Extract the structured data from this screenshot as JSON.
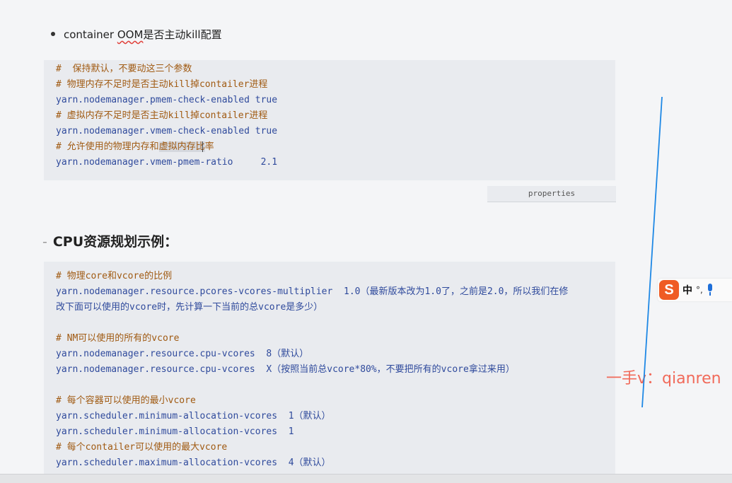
{
  "bullet": {
    "label_prefix": "container ",
    "label_underlined": "OOM",
    "label_suffix": "是否主动kill配置"
  },
  "code1": {
    "lines": [
      {
        "kind": "cmt",
        "text": "#  保持默认，不要动这三个参数"
      },
      {
        "kind": "cmt",
        "text": "# 物理内存不足时是否主动kill掉contailer进程"
      },
      {
        "kind": "cfg",
        "text": "yarn.nodemanager.pmem-check-enabled true"
      },
      {
        "kind": "cmt",
        "text": "# 虚拟内存不足时是否主动kill掉contailer进程"
      },
      {
        "kind": "cfg",
        "text": "yarn.nodemanager.vmem-check-enabled true"
      },
      {
        "kind": "cmt",
        "text": "# 允许使用的物理内存和",
        "hl": "虚拟内存比",
        "after": "率"
      },
      {
        "kind": "cfg",
        "text": "yarn.nodemanager.vmem-pmem-ratio     2.1"
      }
    ],
    "language": "properties"
  },
  "heading": {
    "dash": "-",
    "text": "CPU资源规划示例："
  },
  "code2": {
    "lines": [
      {
        "kind": "cmt",
        "text": "# 物理core和vcore的比例"
      },
      {
        "kind": "cfg",
        "text": "yarn.nodemanager.resource.pcores-vcores-multiplier  1.0（最新版本改为1.0了，之前是2.0，所以我们在修"
      },
      {
        "kind": "cfg",
        "text": "改下面可以使用的vcore时，先计算一下当前的总vcore是多少）"
      },
      {
        "kind": "blank",
        "text": ""
      },
      {
        "kind": "cmt",
        "text": "# NM可以使用的所有的vcore"
      },
      {
        "kind": "cfg",
        "text": "yarn.nodemanager.resource.cpu-vcores  8（默认）"
      },
      {
        "kind": "cfg",
        "text": "yarn.nodemanager.resource.cpu-vcores  X（按照当前总vcore*80%，不要把所有的vcore拿过来用）"
      },
      {
        "kind": "blank",
        "text": ""
      },
      {
        "kind": "cmt",
        "text": "# 每个容器可以使用的最小vcore"
      },
      {
        "kind": "cfg",
        "text": "yarn.scheduler.minimum-allocation-vcores  1（默认）"
      },
      {
        "kind": "cfg",
        "text": "yarn.scheduler.minimum-allocation-vcores  1"
      },
      {
        "kind": "cmt",
        "text": "# 每个contailer可以使用的最大vcore"
      },
      {
        "kind": "cfg",
        "text": "yarn.scheduler.maximum-allocation-vcores  4（默认）"
      }
    ]
  },
  "ime": {
    "logo": "S",
    "mode": "中",
    "punct": "°,"
  },
  "watermark": "一手v：qianren",
  "colors": {
    "comment": "#a05a12",
    "config": "#2f4a9c",
    "annotation_line": "#1e88e5",
    "watermark": "#f16a5a",
    "ime_logo": "#ef5b24"
  }
}
